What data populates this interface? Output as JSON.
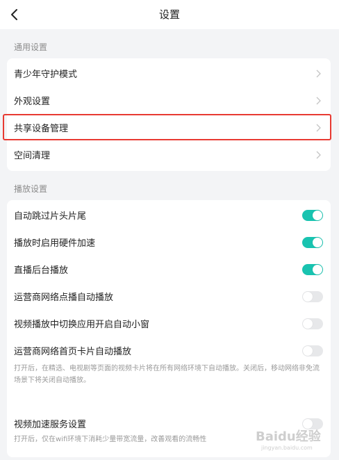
{
  "header": {
    "title": "设置"
  },
  "general": {
    "section_title": "通用设置",
    "items": [
      {
        "label": "青少年守护模式"
      },
      {
        "label": "外观设置"
      },
      {
        "label": "共享设备管理"
      },
      {
        "label": "空间清理"
      }
    ]
  },
  "playback": {
    "section_title": "播放设置",
    "toggles": [
      {
        "label": "自动跳过片头片尾",
        "state": "on"
      },
      {
        "label": "播放时启用硬件加速",
        "state": "on"
      },
      {
        "label": "直播后台播放",
        "state": "on"
      },
      {
        "label": "运营商网络点播自动播放",
        "state": "off"
      },
      {
        "label": "视频播放中切换应用开启自动小窗",
        "state": "off"
      },
      {
        "label": "运营商网络首页卡片自动播放",
        "state": "off"
      },
      {
        "label": "视频加速服务设置",
        "state": "off"
      }
    ],
    "notes": {
      "autoplay_card": "打开后，在精选、电视剧等页面的视频卡片将在所有网络环境下自动播放。关闭后，移动网络非免流场景下将关闭自动播放。",
      "acceleration": "打开后，仅在wifi环境下消耗少量带宽流量，改善观看的流畅性"
    }
  },
  "watermark": {
    "text": "Baidu经验",
    "sub": "jingyan.baidu.com"
  },
  "colors": {
    "toggle_on": "#19c3b0",
    "toggle_off": "#e7e8ea",
    "highlight": "#e83a32",
    "background": "#f3f4f6"
  }
}
